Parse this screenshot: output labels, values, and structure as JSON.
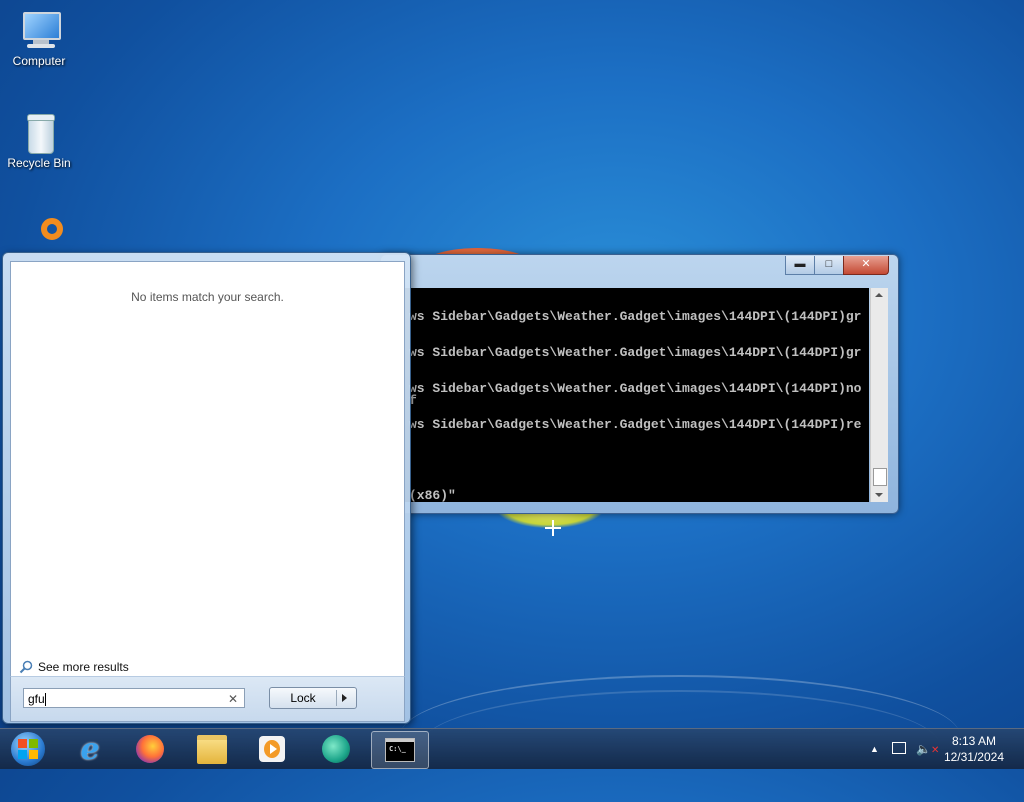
{
  "desktop": {
    "icons": [
      {
        "label": "Computer",
        "icon": "computer-icon"
      },
      {
        "label": "Recycle Bin",
        "icon": "recycle-bin-icon"
      },
      {
        "label": "",
        "icon": "app-shortcut-icon"
      }
    ]
  },
  "console": {
    "buttons": {
      "minimize": "▬",
      "maximize": "□",
      "close": "✕"
    },
    "lines": [
      "ws Sidebar\\Gadgets\\Weather.Gadget\\images\\144DPI\\(144DPI)gr",
      "ws Sidebar\\Gadgets\\Weather.Gadget\\images\\144DPI\\(144DPI)gr",
      "ws Sidebar\\Gadgets\\Weather.Gadget\\images\\144DPI\\(144DPI)no",
      "f",
      "ws Sidebar\\Gadgets\\Weather.Gadget\\images\\144DPI\\(144DPI)re",
      "(x86)\""
    ]
  },
  "start_menu": {
    "no_results_text": "No items match your search.",
    "see_more_label": "See more results",
    "search_value": "gfu",
    "clear_glyph": "✕",
    "lock_label": "Lock"
  },
  "taskbar": {
    "items": [
      {
        "name": "start-orb",
        "icon": "windows-logo-icon"
      },
      {
        "name": "internet-explorer",
        "icon": "internet-explorer-icon"
      },
      {
        "name": "firefox",
        "icon": "firefox-icon"
      },
      {
        "name": "file-explorer",
        "icon": "folder-icon"
      },
      {
        "name": "media-player",
        "icon": "media-player-icon"
      },
      {
        "name": "app",
        "icon": "app-icon"
      },
      {
        "name": "command-prompt",
        "icon": "command-prompt-icon"
      }
    ],
    "clock_time": "8:13 AM",
    "clock_date": "12/31/2024"
  }
}
